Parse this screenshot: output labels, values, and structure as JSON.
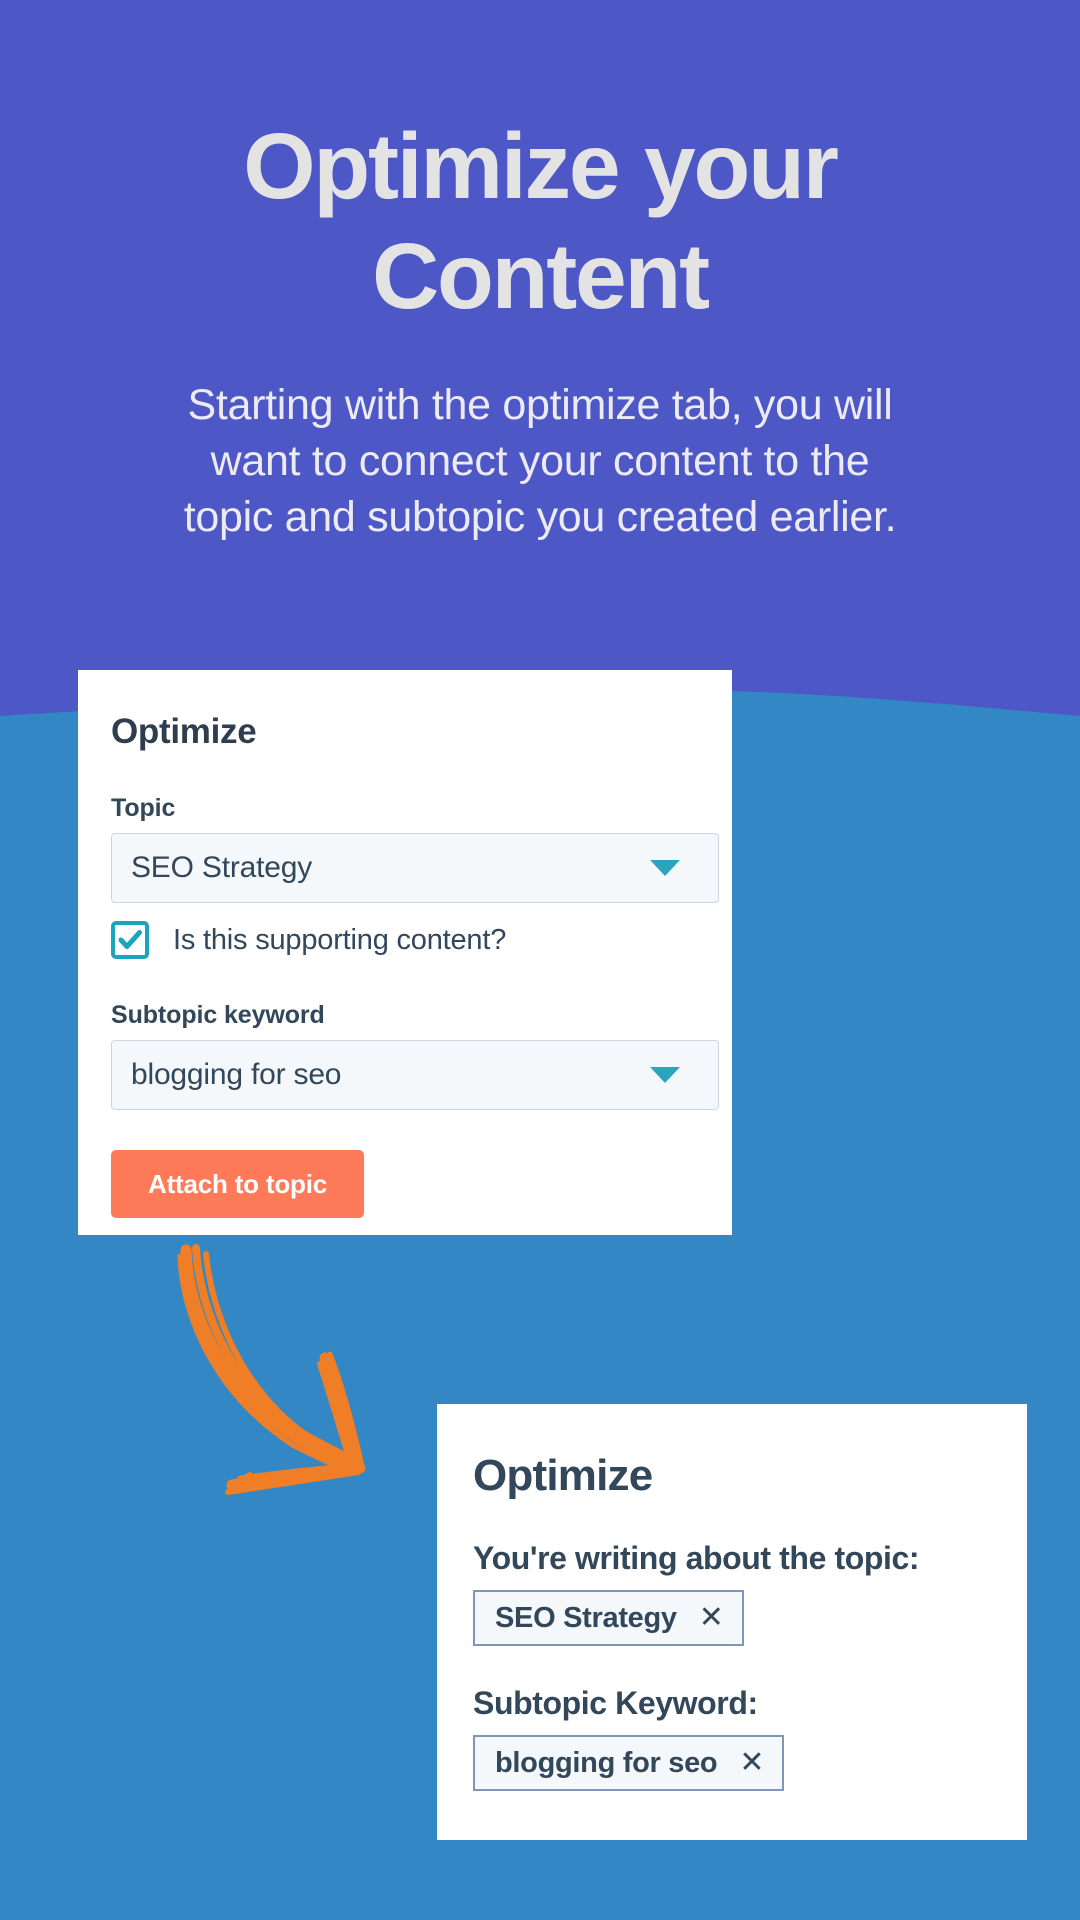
{
  "theme": {
    "purple": "#4d57c6",
    "blue": "#3487c5",
    "orange_accent": "#f07e26",
    "button_orange": "#ff7a59",
    "teal": "#1ba4bd",
    "card_white": "#ffffff",
    "text_dark": "#33475b"
  },
  "hero": {
    "title_line1": "Optimize your",
    "title_line2": "Content",
    "subtitle_line1": "Starting with the optimize tab, you will",
    "subtitle_line2": "want to connect your content to the",
    "subtitle_line3": "topic and subtopic you created earlier."
  },
  "optimize_form": {
    "title": "Optimize",
    "topic_label": "Topic",
    "topic_value": "SEO Strategy",
    "topic_dropdown_icon": "chevron-down-icon",
    "supporting_checkbox_label": "Is this supporting content?",
    "supporting_checkbox_checked": true,
    "subtopic_label": "Subtopic keyword",
    "subtopic_value": "blogging for seo",
    "subtopic_dropdown_icon": "chevron-down-icon",
    "attach_button_label": "Attach to topic"
  },
  "annotation": {
    "icon": "curved-arrow-icon",
    "color": "#f07e26"
  },
  "optimize_result": {
    "title": "Optimize",
    "topic_heading": "You're writing about the topic:",
    "topic_tag": "SEO Strategy",
    "topic_tag_close_icon": "close-icon",
    "subtopic_heading": "Subtopic Keyword:",
    "subtopic_tag": "blogging for seo",
    "subtopic_tag_close_icon": "close-icon",
    "tag_close_glyph": "✕"
  }
}
